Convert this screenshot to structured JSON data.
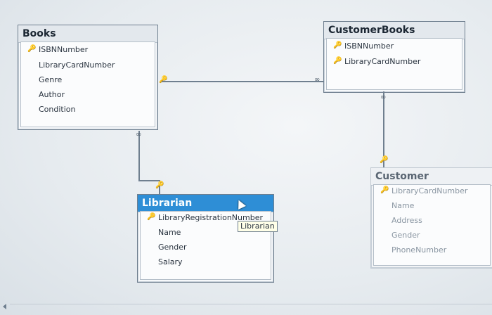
{
  "tables": {
    "books": {
      "title": "Books",
      "fields": [
        "ISBNNumber",
        "LibraryCardNumber",
        "Genre",
        "Author",
        "Condition"
      ]
    },
    "customerbooks": {
      "title": "CustomerBooks",
      "fields": [
        "ISBNNumber",
        "LibraryCardNumber"
      ]
    },
    "librarian": {
      "title": "Librarian",
      "fields": [
        "LibraryRegistrationNumber",
        "Name",
        "Gender",
        "Salary"
      ]
    },
    "customer": {
      "title": "Customer",
      "fields": [
        "LibraryCardNumber",
        "Name",
        "Address",
        "Gender",
        "PhoneNumber"
      ]
    }
  },
  "tooltip": "Librarian",
  "icons": {
    "key": "key-icon",
    "infinity": "infinity-icon"
  },
  "colors": {
    "selected_header": "#2e8ed6",
    "key": "#c9a227"
  }
}
